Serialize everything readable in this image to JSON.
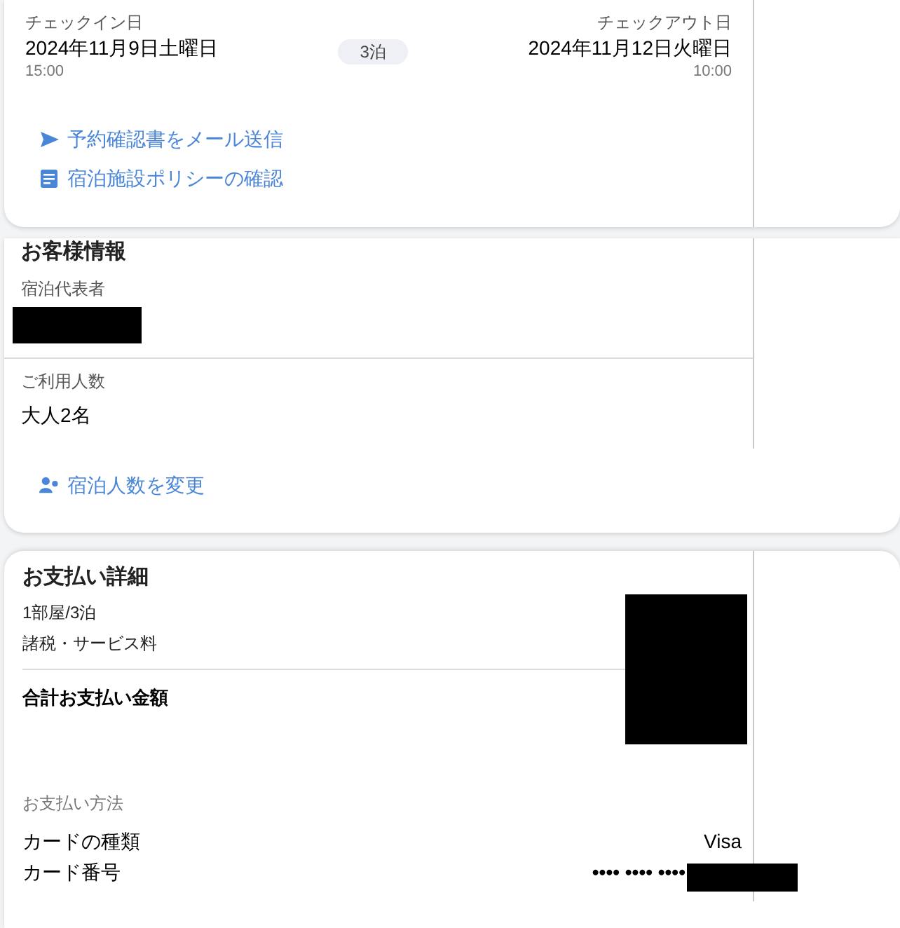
{
  "stay": {
    "checkin": {
      "label": "チェックイン日",
      "date": "2024年11月9日土曜日",
      "time": "15:00"
    },
    "nights": "3泊",
    "checkout": {
      "label": "チェックアウト日",
      "date": "2024年11月12日火曜日",
      "time": "10:00"
    },
    "links": [
      {
        "kind": "send",
        "label": "予約確認書をメール送信"
      },
      {
        "kind": "pdf",
        "label": "宿泊施設ポリシーの確認"
      }
    ]
  },
  "guest_info": {
    "title": "お客様情報",
    "representative_label": "宿泊代表者",
    "guests_label": "ご利用人数",
    "guests_value": "大人2名",
    "change_link": "宿泊人数を変更"
  },
  "payment": {
    "title": "お支払い詳細",
    "lines": [
      "1部屋/3泊",
      "諸税・サービス料"
    ],
    "total_label": "合計お支払い金額",
    "method_label": "お支払い方法",
    "rows": [
      {
        "label": "カードの種類",
        "value": "Visa"
      },
      {
        "label": "カード番号",
        "value": "•••• •••• ••••"
      }
    ]
  }
}
